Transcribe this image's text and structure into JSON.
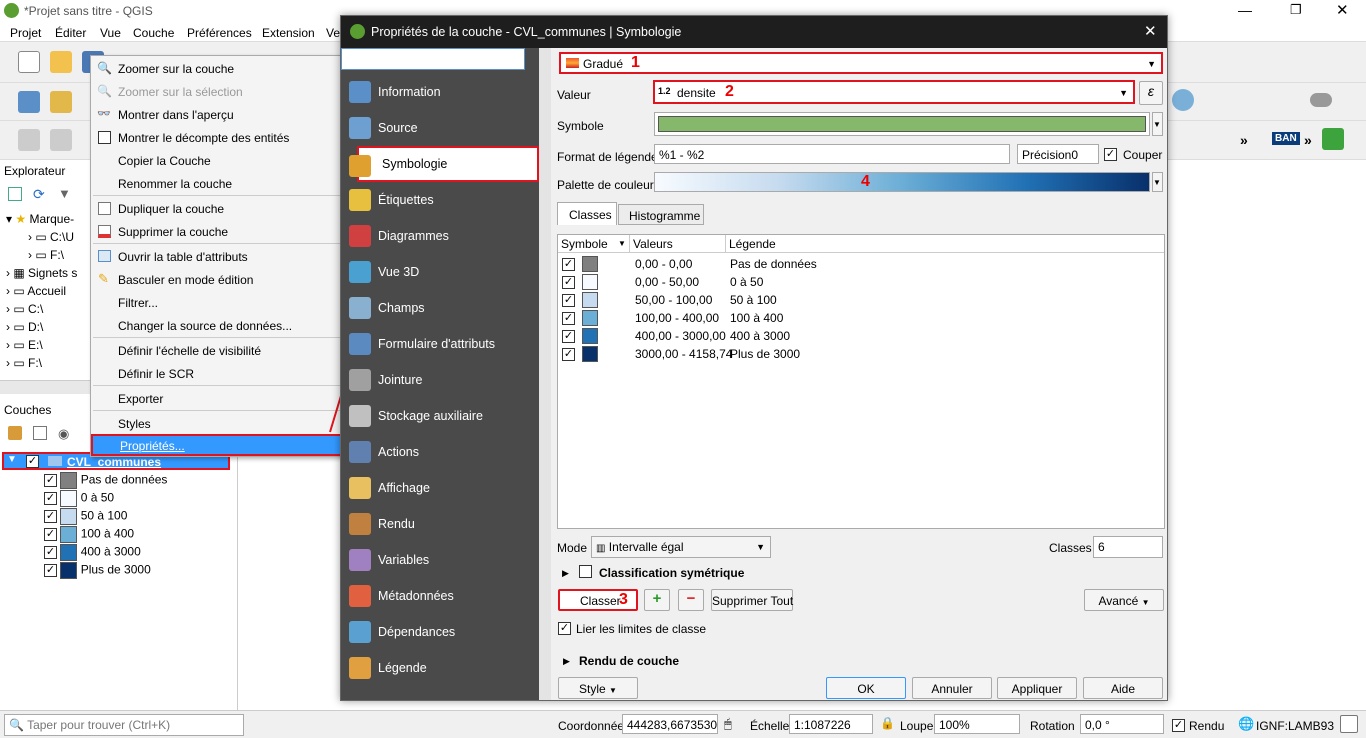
{
  "window": {
    "title": "*Projet sans titre - QGIS"
  },
  "menubar": [
    "Projet",
    "Éditer",
    "Vue",
    "Couche",
    "Préférences",
    "Extension",
    "Ve"
  ],
  "toolbar": {
    "ban_label": "BAN",
    "more_label": "»"
  },
  "explorer": {
    "title": "Explorateur",
    "items": [
      "Marque-",
      "C:\\U",
      "F:\\",
      "Signets s",
      "Accueil",
      "C:\\",
      "D:\\",
      "E:\\",
      "F:\\"
    ]
  },
  "layers": {
    "title": "Couches",
    "layer_name": "CVL_communes",
    "legend": [
      {
        "label": "Pas de données",
        "color": "#808080"
      },
      {
        "label": "0 à 50",
        "color": "#f7fbff"
      },
      {
        "label": "50 à 100",
        "color": "#c6dbef"
      },
      {
        "label": "100 à 400",
        "color": "#6baed6"
      },
      {
        "label": "400 à 3000",
        "color": "#2171b5"
      },
      {
        "label": "Plus de 3000",
        "color": "#08306b"
      }
    ]
  },
  "context_menu": {
    "items": [
      {
        "label": "Zoomer sur la couche"
      },
      {
        "label": "Zoomer sur la sélection"
      },
      {
        "label": "Montrer dans l'aperçu"
      },
      {
        "label": "Montrer le décompte des entités"
      },
      {
        "label": "Copier la Couche"
      },
      {
        "label": "Renommer la couche"
      },
      {
        "label": "Dupliquer la couche"
      },
      {
        "label": "Supprimer la couche"
      },
      {
        "label": "Ouvrir la table d'attributs"
      },
      {
        "label": "Basculer en mode édition"
      },
      {
        "label": "Filtrer..."
      },
      {
        "label": "Changer la source de données..."
      },
      {
        "label": "Définir l'échelle de visibilité"
      },
      {
        "label": "Définir le SCR"
      },
      {
        "label": "Exporter"
      },
      {
        "label": "Styles"
      },
      {
        "label": "Propriétés..."
      }
    ]
  },
  "dialog": {
    "title": "Propriétés de la couche - CVL_communes | Symbologie",
    "sidebar": [
      "Information",
      "Source",
      "Symbologie",
      "Étiquettes",
      "Diagrammes",
      "Vue 3D",
      "Champs",
      "Formulaire d'attributs",
      "Jointure",
      "Stockage auxiliaire",
      "Actions",
      "Affichage",
      "Rendu",
      "Variables",
      "Métadonnées",
      "Dépendances",
      "Légende"
    ],
    "renderer": "Gradué",
    "markers": [
      "1",
      "2",
      "3",
      "4"
    ],
    "valeur_label": "Valeur",
    "valeur_prefix": "1.2",
    "valeur_field": "densite",
    "symbole_label": "Symbole",
    "symbol_color": "#86b86b",
    "format_label": "Format de légende",
    "format_value": "%1 - %2",
    "precision_label": "Précision",
    "precision_value": "0",
    "couper_label": "Couper",
    "palette_label": "Palette de couleur",
    "tabs": [
      "Classes",
      "Histogramme"
    ],
    "table_headers": [
      "Symbole",
      "Valeurs",
      "Légende"
    ],
    "classes": [
      {
        "valeurs": "0,00 - 0,00",
        "legende": "Pas de données",
        "color": "#808080"
      },
      {
        "valeurs": "0,00 - 50,00",
        "legende": "0 à 50",
        "color": "#f7fbff"
      },
      {
        "valeurs": "50,00 - 100,00",
        "legende": "50 à 100",
        "color": "#c6dbef"
      },
      {
        "valeurs": "100,00 - 400,00",
        "legende": "100 à 400",
        "color": "#6baed6"
      },
      {
        "valeurs": "400,00 - 3000,00",
        "legende": "400 à 3000",
        "color": "#2171b5"
      },
      {
        "valeurs": "3000,00 - 4158,74",
        "legende": "Plus de 3000",
        "color": "#08306b"
      }
    ],
    "mode_label": "Mode",
    "mode_value": "Intervalle égal",
    "classes_label": "Classes",
    "classes_count": "6",
    "sym_class_label": "Classification symétrique",
    "classer_button": "Classer",
    "supprimer_tout_button": "Supprimer Tout",
    "avance_button": "Avancé",
    "lier_label": "Lier les limites de classe",
    "rendu_label": "Rendu de couche",
    "style_button": "Style",
    "ok_button": "OK",
    "annuler_button": "Annuler",
    "appliquer_button": "Appliquer",
    "aide_button": "Aide"
  },
  "statusbar": {
    "search_placeholder": "Taper pour trouver (Ctrl+K)",
    "coord_label": "Coordonnée",
    "coord_value": "444283,6673530",
    "echelle_label": "Échelle",
    "echelle_value": "1:1087226",
    "loupe_label": "Loupe",
    "loupe_value": "100%",
    "rotation_label": "Rotation",
    "rotation_value": "0,0 °",
    "rendu_label": "Rendu",
    "crs": "IGNF:LAMB93"
  }
}
